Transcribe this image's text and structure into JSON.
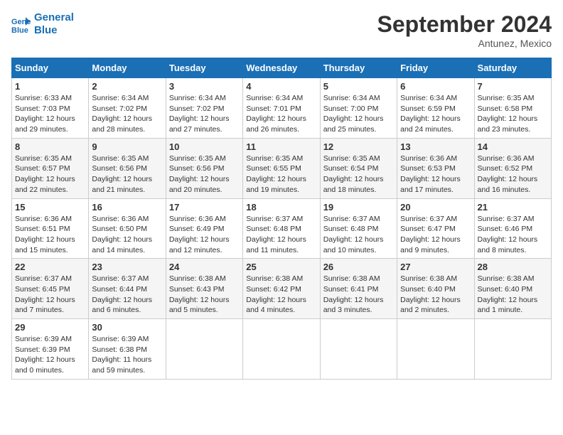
{
  "header": {
    "logo_line1": "General",
    "logo_line2": "Blue",
    "month": "September 2024",
    "location": "Antunez, Mexico"
  },
  "days_of_week": [
    "Sunday",
    "Monday",
    "Tuesday",
    "Wednesday",
    "Thursday",
    "Friday",
    "Saturday"
  ],
  "weeks": [
    [
      {
        "day": "1",
        "info": "Sunrise: 6:33 AM\nSunset: 7:03 PM\nDaylight: 12 hours\nand 29 minutes."
      },
      {
        "day": "2",
        "info": "Sunrise: 6:34 AM\nSunset: 7:02 PM\nDaylight: 12 hours\nand 28 minutes."
      },
      {
        "day": "3",
        "info": "Sunrise: 6:34 AM\nSunset: 7:02 PM\nDaylight: 12 hours\nand 27 minutes."
      },
      {
        "day": "4",
        "info": "Sunrise: 6:34 AM\nSunset: 7:01 PM\nDaylight: 12 hours\nand 26 minutes."
      },
      {
        "day": "5",
        "info": "Sunrise: 6:34 AM\nSunset: 7:00 PM\nDaylight: 12 hours\nand 25 minutes."
      },
      {
        "day": "6",
        "info": "Sunrise: 6:34 AM\nSunset: 6:59 PM\nDaylight: 12 hours\nand 24 minutes."
      },
      {
        "day": "7",
        "info": "Sunrise: 6:35 AM\nSunset: 6:58 PM\nDaylight: 12 hours\nand 23 minutes."
      }
    ],
    [
      {
        "day": "8",
        "info": "Sunrise: 6:35 AM\nSunset: 6:57 PM\nDaylight: 12 hours\nand 22 minutes."
      },
      {
        "day": "9",
        "info": "Sunrise: 6:35 AM\nSunset: 6:56 PM\nDaylight: 12 hours\nand 21 minutes."
      },
      {
        "day": "10",
        "info": "Sunrise: 6:35 AM\nSunset: 6:56 PM\nDaylight: 12 hours\nand 20 minutes."
      },
      {
        "day": "11",
        "info": "Sunrise: 6:35 AM\nSunset: 6:55 PM\nDaylight: 12 hours\nand 19 minutes."
      },
      {
        "day": "12",
        "info": "Sunrise: 6:35 AM\nSunset: 6:54 PM\nDaylight: 12 hours\nand 18 minutes."
      },
      {
        "day": "13",
        "info": "Sunrise: 6:36 AM\nSunset: 6:53 PM\nDaylight: 12 hours\nand 17 minutes."
      },
      {
        "day": "14",
        "info": "Sunrise: 6:36 AM\nSunset: 6:52 PM\nDaylight: 12 hours\nand 16 minutes."
      }
    ],
    [
      {
        "day": "15",
        "info": "Sunrise: 6:36 AM\nSunset: 6:51 PM\nDaylight: 12 hours\nand 15 minutes."
      },
      {
        "day": "16",
        "info": "Sunrise: 6:36 AM\nSunset: 6:50 PM\nDaylight: 12 hours\nand 14 minutes."
      },
      {
        "day": "17",
        "info": "Sunrise: 6:36 AM\nSunset: 6:49 PM\nDaylight: 12 hours\nand 12 minutes."
      },
      {
        "day": "18",
        "info": "Sunrise: 6:37 AM\nSunset: 6:48 PM\nDaylight: 12 hours\nand 11 minutes."
      },
      {
        "day": "19",
        "info": "Sunrise: 6:37 AM\nSunset: 6:48 PM\nDaylight: 12 hours\nand 10 minutes."
      },
      {
        "day": "20",
        "info": "Sunrise: 6:37 AM\nSunset: 6:47 PM\nDaylight: 12 hours\nand 9 minutes."
      },
      {
        "day": "21",
        "info": "Sunrise: 6:37 AM\nSunset: 6:46 PM\nDaylight: 12 hours\nand 8 minutes."
      }
    ],
    [
      {
        "day": "22",
        "info": "Sunrise: 6:37 AM\nSunset: 6:45 PM\nDaylight: 12 hours\nand 7 minutes."
      },
      {
        "day": "23",
        "info": "Sunrise: 6:37 AM\nSunset: 6:44 PM\nDaylight: 12 hours\nand 6 minutes."
      },
      {
        "day": "24",
        "info": "Sunrise: 6:38 AM\nSunset: 6:43 PM\nDaylight: 12 hours\nand 5 minutes."
      },
      {
        "day": "25",
        "info": "Sunrise: 6:38 AM\nSunset: 6:42 PM\nDaylight: 12 hours\nand 4 minutes."
      },
      {
        "day": "26",
        "info": "Sunrise: 6:38 AM\nSunset: 6:41 PM\nDaylight: 12 hours\nand 3 minutes."
      },
      {
        "day": "27",
        "info": "Sunrise: 6:38 AM\nSunset: 6:40 PM\nDaylight: 12 hours\nand 2 minutes."
      },
      {
        "day": "28",
        "info": "Sunrise: 6:38 AM\nSunset: 6:40 PM\nDaylight: 12 hours\nand 1 minute."
      }
    ],
    [
      {
        "day": "29",
        "info": "Sunrise: 6:39 AM\nSunset: 6:39 PM\nDaylight: 12 hours\nand 0 minutes."
      },
      {
        "day": "30",
        "info": "Sunrise: 6:39 AM\nSunset: 6:38 PM\nDaylight: 11 hours\nand 59 minutes."
      },
      {
        "day": "",
        "info": ""
      },
      {
        "day": "",
        "info": ""
      },
      {
        "day": "",
        "info": ""
      },
      {
        "day": "",
        "info": ""
      },
      {
        "day": "",
        "info": ""
      }
    ]
  ]
}
